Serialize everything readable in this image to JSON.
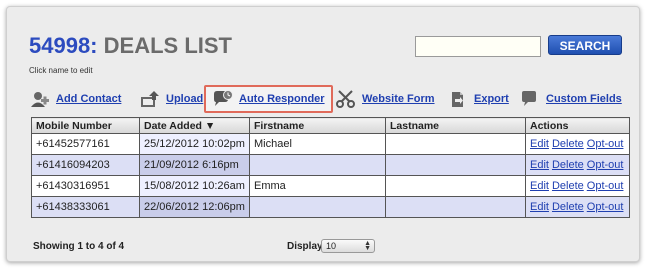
{
  "header": {
    "list_id": "54998:",
    "title": "DEALS LIST",
    "hint": "Click name to edit"
  },
  "search": {
    "value": "",
    "button_label": "SEARCH"
  },
  "toolbar": {
    "items": [
      {
        "label": "Add Contact",
        "icon": "add-contact-icon"
      },
      {
        "label": "Upload",
        "icon": "upload-icon"
      },
      {
        "label": "Auto Responder",
        "icon": "auto-responder-icon",
        "highlighted": true
      },
      {
        "label": "Website Form",
        "icon": "scissors-icon"
      },
      {
        "label": "Export",
        "icon": "export-icon"
      },
      {
        "label": "Custom Fields",
        "icon": "speech-bubble-icon"
      }
    ]
  },
  "table": {
    "columns": [
      "Mobile Number",
      "Date Added ▼",
      "Firstname",
      "Lastname",
      "Actions"
    ],
    "rows": [
      {
        "mobile": "+61452577161",
        "date": "25/12/2012 10:02pm",
        "firstname": "Michael",
        "lastname": ""
      },
      {
        "mobile": "+61416094203",
        "date": "21/09/2012 6:16pm",
        "firstname": "",
        "lastname": ""
      },
      {
        "mobile": "+61430316951",
        "date": "15/08/2012 10:26am",
        "firstname": "Emma",
        "lastname": ""
      },
      {
        "mobile": "+61438333061",
        "date": "22/06/2012 12:06pm",
        "firstname": "",
        "lastname": ""
      }
    ],
    "actions": {
      "edit": "Edit",
      "delete": "Delete",
      "optout": "Opt-out"
    }
  },
  "footer": {
    "count_text": "Showing 1 to 4 of 4",
    "display_label": "Display",
    "display_value": "10"
  },
  "colors": {
    "accent_blue": "#2c4bbf",
    "link_blue": "#1f3fb0",
    "highlight_border": "#e06a5a",
    "alt_row": "#dcdff5"
  }
}
